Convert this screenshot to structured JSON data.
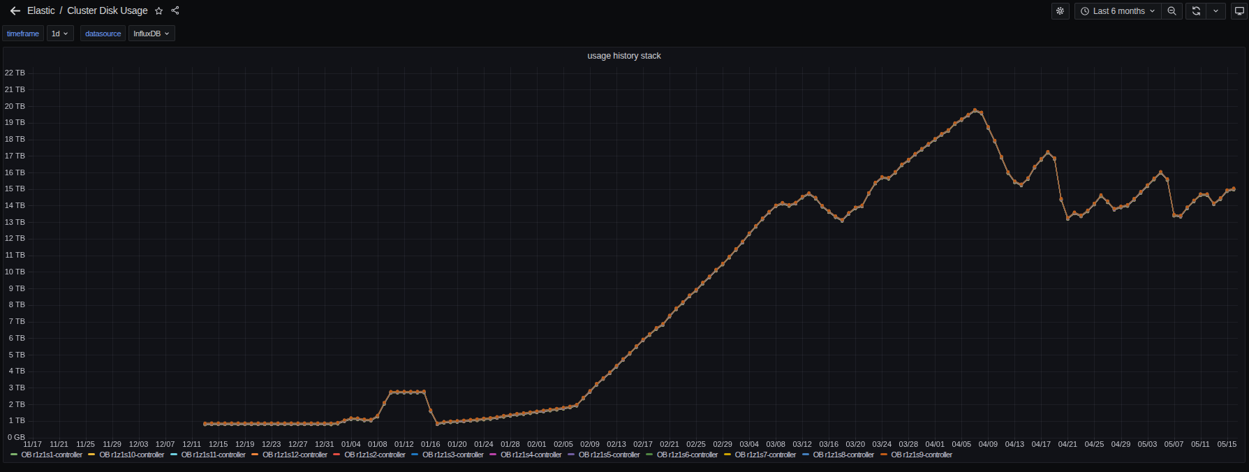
{
  "nav": {
    "back_icon": "arrow-left-icon",
    "breadcrumb": {
      "folder": "Elastic",
      "separator": "/",
      "dashboard": "Cluster Disk Usage"
    },
    "star_icon": "star-icon",
    "share_icon": "share-alt-icon",
    "actions": {
      "settings_icon": "gear-icon",
      "time_range": {
        "clock_icon": "clock-icon",
        "label": "Last 6 months",
        "caret_icon": "chevron-down-icon"
      },
      "zoom_out_icon": "search-minus-icon",
      "refresh_icon": "refresh-icon",
      "refresh_caret_icon": "chevron-down-icon",
      "kiosk_icon": "monitor-icon"
    }
  },
  "submenu": {
    "variables": [
      {
        "label": "timeframe",
        "value": "1d"
      },
      {
        "label": "datasource",
        "value": "InfluxDB"
      }
    ]
  },
  "panel": {
    "title": "usage history stack"
  },
  "chart_data": {
    "type": "line",
    "title": "usage history stack",
    "stacking": true,
    "show_points": true,
    "grid": true,
    "legend_position": "bottom",
    "xlabel": "",
    "ylabel": "",
    "y_unit": "bytes",
    "ylim_tb": [
      0,
      22
    ],
    "y_tick_labels": [
      "0 GB",
      "1 TB",
      "2 TB",
      "3 TB",
      "4 TB",
      "5 TB",
      "6 TB",
      "7 TB",
      "8 TB",
      "9 TB",
      "10 TB",
      "11 TB",
      "12 TB",
      "13 TB",
      "14 TB",
      "15 TB",
      "16 TB",
      "17 TB",
      "18 TB",
      "19 TB",
      "20 TB",
      "21 TB",
      "22 TB"
    ],
    "x_tick_labels": [
      "11/17",
      "11/21",
      "11/25",
      "11/29",
      "12/03",
      "12/07",
      "12/11",
      "12/15",
      "12/19",
      "12/23",
      "12/27",
      "12/31",
      "01/04",
      "01/08",
      "01/12",
      "01/16",
      "01/20",
      "01/24",
      "01/28",
      "02/01",
      "02/05",
      "02/09",
      "02/13",
      "02/17",
      "02/21",
      "02/25",
      "02/29",
      "03/04",
      "03/08",
      "03/12",
      "03/16",
      "03/20",
      "03/24",
      "03/28",
      "04/01",
      "04/05",
      "04/09",
      "04/13",
      "04/17",
      "04/21",
      "04/25",
      "04/29",
      "05/03",
      "05/07",
      "05/11",
      "05/15"
    ],
    "x_range": [
      "11/17",
      "05/16"
    ],
    "dates": [
      "12/13",
      "12/14",
      "12/15",
      "12/16",
      "12/17",
      "12/18",
      "12/19",
      "12/20",
      "12/21",
      "12/22",
      "12/23",
      "12/24",
      "12/25",
      "12/26",
      "12/27",
      "12/28",
      "12/29",
      "12/30",
      "12/31",
      "01/01",
      "01/02",
      "01/03",
      "01/04",
      "01/05",
      "01/06",
      "01/07",
      "01/08",
      "01/09",
      "01/10",
      "01/11",
      "01/12",
      "01/13",
      "01/14",
      "01/15",
      "01/16",
      "01/17",
      "01/18",
      "01/19",
      "01/20",
      "01/21",
      "01/22",
      "01/23",
      "01/24",
      "01/25",
      "01/26",
      "01/27",
      "01/28",
      "01/29",
      "01/30",
      "01/31",
      "02/01",
      "02/02",
      "02/03",
      "02/04",
      "02/05",
      "02/06",
      "02/07",
      "02/08",
      "02/09",
      "02/10",
      "02/11",
      "02/12",
      "02/13",
      "02/14",
      "02/15",
      "02/16",
      "02/17",
      "02/18",
      "02/19",
      "02/20",
      "02/21",
      "02/22",
      "02/23",
      "02/24",
      "02/25",
      "02/26",
      "02/27",
      "02/28",
      "02/29",
      "03/01",
      "03/02",
      "03/03",
      "03/04",
      "03/05",
      "03/06",
      "03/07",
      "03/08",
      "03/09",
      "03/10",
      "03/11",
      "03/12",
      "03/13",
      "03/14",
      "03/15",
      "03/16",
      "03/17",
      "03/18",
      "03/19",
      "03/20",
      "03/21",
      "03/22",
      "03/23",
      "03/24",
      "03/25",
      "03/26",
      "03/27",
      "03/28",
      "03/29",
      "03/30",
      "03/31",
      "04/01",
      "04/02",
      "04/03",
      "04/04",
      "04/05",
      "04/06",
      "04/07",
      "04/08",
      "04/09",
      "04/10",
      "04/11",
      "04/12",
      "04/13",
      "04/14",
      "04/15",
      "04/16",
      "04/17",
      "04/18",
      "04/19",
      "04/20",
      "04/21",
      "04/22",
      "04/23",
      "04/24",
      "04/25",
      "04/26",
      "04/27",
      "04/28",
      "04/29",
      "04/30",
      "05/01",
      "05/02",
      "05/03",
      "05/04",
      "05/05",
      "05/06",
      "05/07",
      "05/08",
      "05/09",
      "05/10",
      "05/11",
      "05/12",
      "05/13",
      "05/14",
      "05/15",
      "05/16"
    ],
    "stack_total_tb": [
      0.87,
      0.88,
      0.88,
      0.88,
      0.88,
      0.88,
      0.88,
      0.88,
      0.88,
      0.88,
      0.88,
      0.88,
      0.88,
      0.88,
      0.88,
      0.88,
      0.88,
      0.88,
      0.88,
      0.875,
      0.91,
      1.06,
      1.19,
      1.18,
      1.11,
      1.1,
      1.34,
      2.11,
      2.78,
      2.79,
      2.79,
      2.79,
      2.79,
      2.8,
      1.66,
      0.88,
      0.97,
      1.0,
      1.02,
      1.05,
      1.09,
      1.12,
      1.17,
      1.2,
      1.26,
      1.33,
      1.39,
      1.45,
      1.49,
      1.55,
      1.6,
      1.65,
      1.71,
      1.76,
      1.82,
      1.89,
      2.0,
      2.43,
      2.83,
      3.26,
      3.61,
      3.96,
      4.35,
      4.76,
      5.13,
      5.54,
      5.94,
      6.27,
      6.63,
      6.88,
      7.38,
      7.82,
      8.19,
      8.6,
      8.94,
      9.37,
      9.74,
      10.15,
      10.52,
      10.94,
      11.4,
      11.85,
      12.35,
      12.8,
      13.25,
      13.65,
      14.03,
      14.19,
      14.06,
      14.2,
      14.56,
      14.77,
      14.5,
      14.01,
      13.69,
      13.38,
      13.16,
      13.58,
      13.91,
      14.03,
      14.78,
      15.41,
      15.75,
      15.7,
      16.05,
      16.51,
      16.79,
      17.15,
      17.45,
      17.75,
      18.05,
      18.35,
      18.58,
      19.0,
      19.24,
      19.51,
      19.8,
      19.64,
      18.77,
      17.94,
      16.97,
      16.04,
      15.49,
      15.3,
      15.68,
      16.37,
      16.84,
      17.27,
      16.89,
      14.43,
      13.28,
      13.61,
      13.43,
      13.73,
      14.15,
      14.65,
      14.28,
      13.83,
      13.97,
      14.06,
      14.43,
      14.85,
      15.25,
      15.66,
      16.05,
      15.62,
      13.47,
      13.41,
      13.92,
      14.33,
      14.71,
      14.71,
      14.16,
      14.47,
      14.95,
      15.05
    ],
    "minor_series_tb": 0.009,
    "series": [
      {
        "name": "OB r1z1s1-controller",
        "color": "#7EB26D"
      },
      {
        "name": "OB r1z1s10-controller",
        "color": "#EAB839"
      },
      {
        "name": "OB r1z1s11-controller",
        "color": "#6ED0E0"
      },
      {
        "name": "OB r1z1s12-controller",
        "color": "#EF843C"
      },
      {
        "name": "OB r1z1s2-controller",
        "color": "#E24D42"
      },
      {
        "name": "OB r1z1s3-controller",
        "color": "#1F78C1"
      },
      {
        "name": "OB r1z1s4-controller",
        "color": "#BA43A9"
      },
      {
        "name": "OB r1z1s5-controller",
        "color": "#705DA0"
      },
      {
        "name": "OB r1z1s6-controller",
        "color": "#508642"
      },
      {
        "name": "OB r1z1s7-controller",
        "color": "#CCA300"
      },
      {
        "name": "OB r1z1s8-controller",
        "color": "#447EBC"
      },
      {
        "name": "OB r1z1s9-controller",
        "color": "#C15C17"
      }
    ],
    "colors": {
      "grid": "rgba(204,204,220,0.07)",
      "axis_text": "#c3c4cc",
      "accent_blue": "#6E9FFF"
    }
  },
  "legend": {
    "items": [
      {
        "name": "OB r1z1s1-controller",
        "color": "#7EB26D"
      },
      {
        "name": "OB r1z1s10-controller",
        "color": "#EAB839"
      },
      {
        "name": "OB r1z1s11-controller",
        "color": "#6ED0E0"
      },
      {
        "name": "OB r1z1s12-controller",
        "color": "#EF843C"
      },
      {
        "name": "OB r1z1s2-controller",
        "color": "#E24D42"
      },
      {
        "name": "OB r1z1s3-controller",
        "color": "#1F78C1"
      },
      {
        "name": "OB r1z1s4-controller",
        "color": "#BA43A9"
      },
      {
        "name": "OB r1z1s5-controller",
        "color": "#705DA0"
      },
      {
        "name": "OB r1z1s6-controller",
        "color": "#508642"
      },
      {
        "name": "OB r1z1s7-controller",
        "color": "#CCA300"
      },
      {
        "name": "OB r1z1s8-controller",
        "color": "#447EBC"
      },
      {
        "name": "OB r1z1s9-controller",
        "color": "#C15C17"
      }
    ]
  }
}
